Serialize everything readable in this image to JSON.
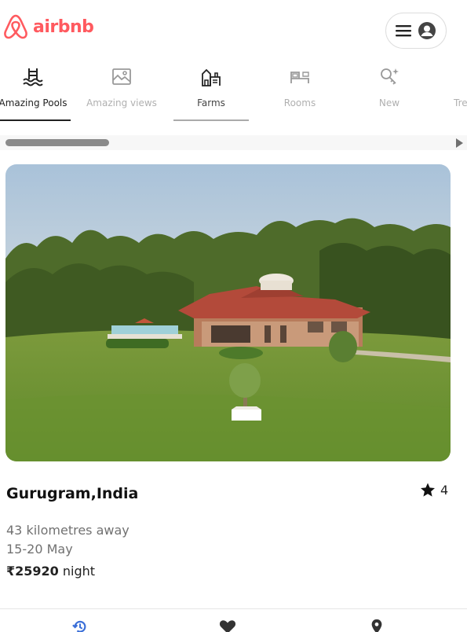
{
  "header": {
    "brand": "airbnb",
    "brand_color": "#ff5a5f"
  },
  "categories": [
    {
      "label": "Amazing Pools",
      "icon": "pool-icon",
      "state": "active"
    },
    {
      "label": "Amazing views",
      "icon": "views-icon",
      "state": "inactive"
    },
    {
      "label": "Farms",
      "icon": "farm-icon",
      "state": "semi"
    },
    {
      "label": "Rooms",
      "icon": "rooms-icon",
      "state": "inactive"
    },
    {
      "label": "New",
      "icon": "sparkle-key-icon",
      "state": "inactive"
    },
    {
      "label": "Tre",
      "icon": "",
      "state": "inactive"
    }
  ],
  "scroll": {
    "position": 0.0
  },
  "listing": {
    "location": "Gurugram,India",
    "rating": "4",
    "distance": "43 kilometres away",
    "dates": "15-20 May",
    "price": "₹25920",
    "price_unit": " night"
  },
  "bottom_nav": [
    {
      "icon": "history-icon",
      "color": "#3b6fd8"
    },
    {
      "icon": "heart-icon",
      "color": "#333333"
    },
    {
      "icon": "location-pin-icon",
      "color": "#333333"
    }
  ]
}
